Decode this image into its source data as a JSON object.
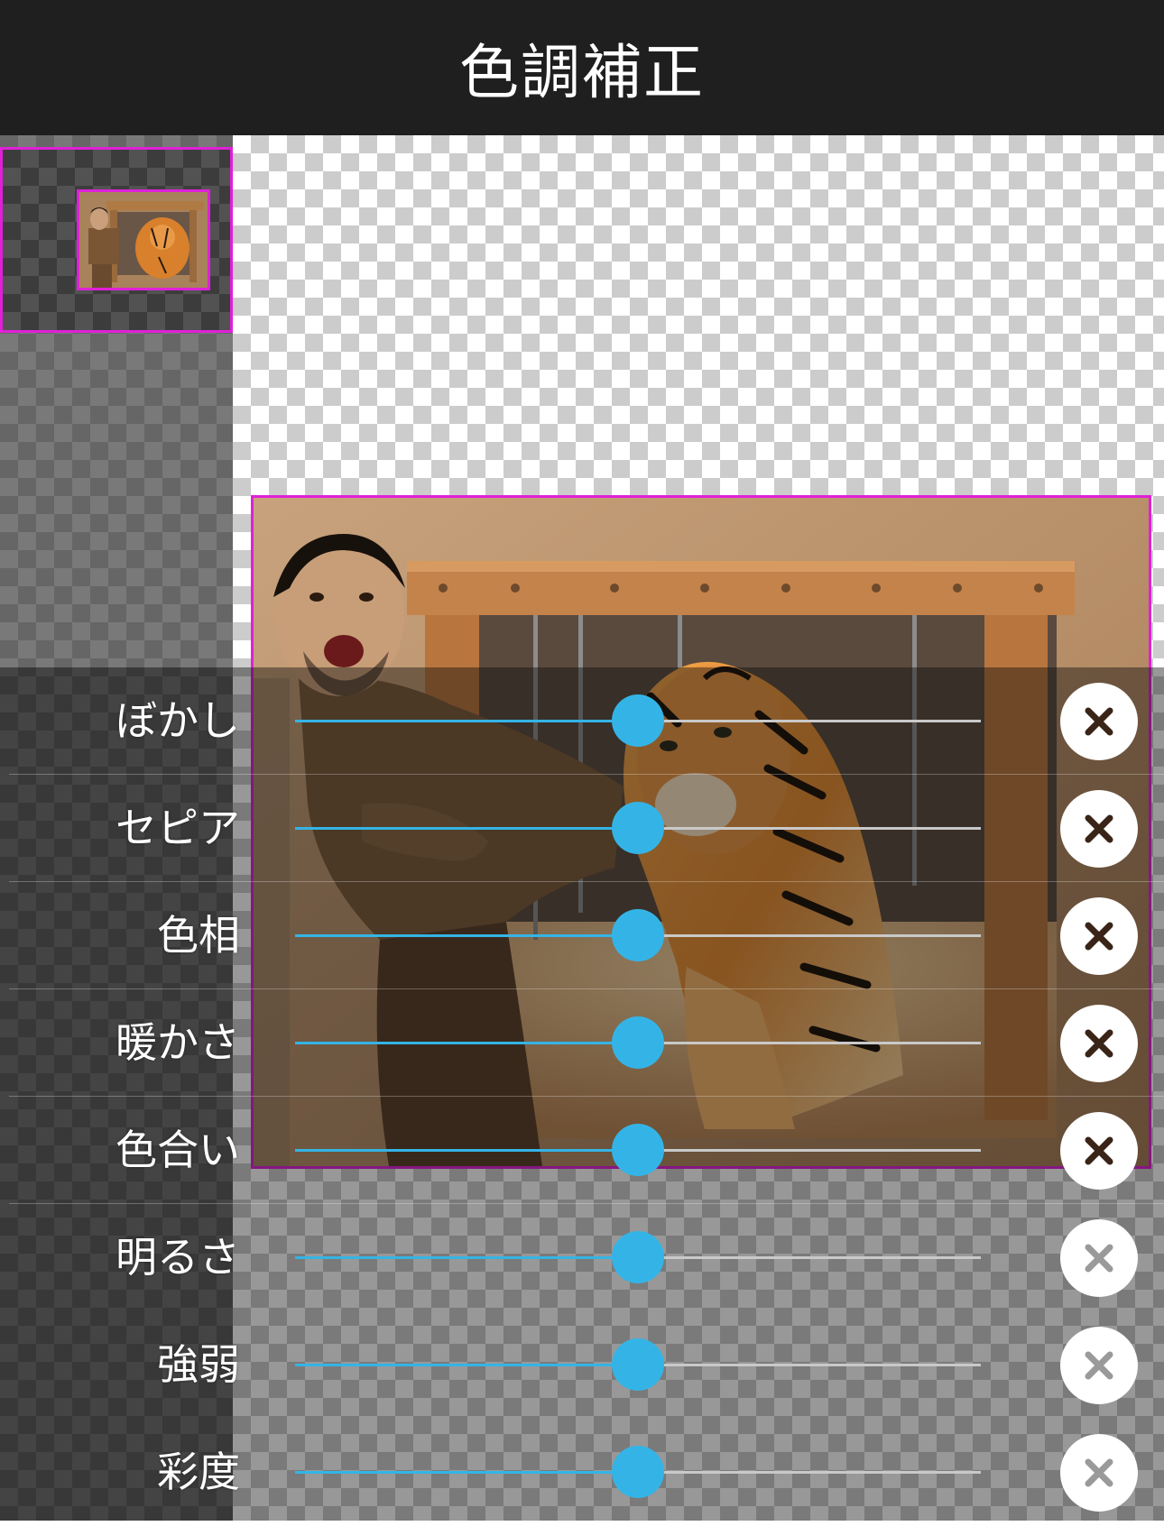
{
  "header": {
    "title": "色調補正"
  },
  "colors": {
    "header_bg": "#1f1f1f",
    "accent": "#34b4e6",
    "selection": "#e020d8"
  },
  "adjustments": [
    {
      "label": "ぼかし",
      "value": 0.5
    },
    {
      "label": "セピア",
      "value": 0.5
    },
    {
      "label": "色相",
      "value": 0.5
    },
    {
      "label": "暖かさ",
      "value": 0.5
    },
    {
      "label": "色合い",
      "value": 0.5
    },
    {
      "label": "明るさ",
      "value": 0.5
    },
    {
      "label": "強弱",
      "value": 0.5
    },
    {
      "label": "彩度",
      "value": 0.5
    }
  ],
  "icons": {
    "reset": "close-icon"
  }
}
